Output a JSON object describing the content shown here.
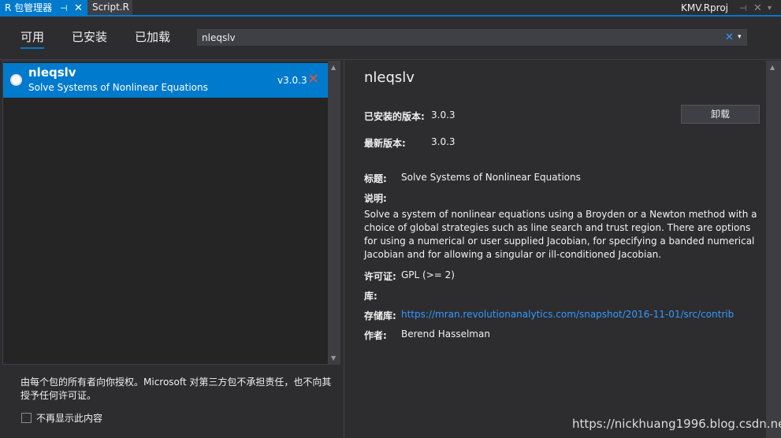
{
  "tabs": {
    "active": {
      "label": "R 包管理器",
      "pin": "⊣",
      "close": "✕"
    },
    "script": {
      "label": "Script.R"
    },
    "rproj": {
      "label": "KMV.Rproj",
      "pin": "⊣",
      "close": "✕",
      "drop": "▾"
    }
  },
  "filters": {
    "available": "可用",
    "installed": "已安装",
    "loaded": "已加载"
  },
  "search": {
    "value": "nleqslv",
    "clear": "✕",
    "drop": "▾"
  },
  "list": {
    "package": {
      "name": "nleqslv",
      "description": "Solve Systems of Nonlinear Equations",
      "version": "v3.0.3",
      "remove": "✕"
    },
    "scroll_up": "▲",
    "scroll_down": "▼"
  },
  "footer": {
    "note": "由每个包的所有者向你授权。Microsoft 对第三方包不承担责任，也不向其授予任何许可证。",
    "checkbox_label": "不再显示此内容"
  },
  "detail": {
    "title": "nleqslv",
    "installed_version_label": "已安装的版本:",
    "installed_version": "3.0.3",
    "uninstall_label": "卸载",
    "latest_version_label": "最新版本:",
    "latest_version": "3.0.3",
    "heading_label": "标题:",
    "heading": "Solve Systems of Nonlinear Equations",
    "description_label": "说明:",
    "description": "Solve a system of nonlinear equations using a Broyden or a Newton method with a choice of global strategies such as line search and trust region. There are options for using a numerical or user supplied Jacobian, for specifying a banded numerical Jacobian and for allowing a singular or ill-conditioned Jacobian.",
    "license_label": "许可证:",
    "license": "GPL (>= 2)",
    "library_label": "库:",
    "repo_label": "存储库:",
    "repo": "https://mran.revolutionanalytics.com/snapshot/2016-11-01/src/contrib",
    "author_label": "作者:",
    "author": "Berend Hasselman",
    "scroll_up": "▲"
  },
  "watermark": "https://nickhuang1996.blog.csdn.net"
}
